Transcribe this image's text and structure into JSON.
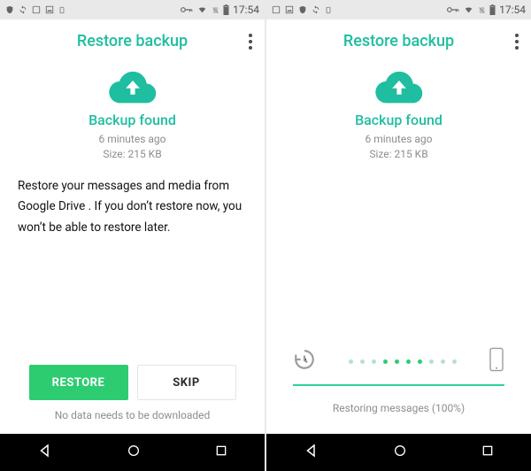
{
  "statusbar": {
    "time": "17:54"
  },
  "left": {
    "title": "Restore backup",
    "backup_found": "Backup found",
    "time_ago": "6 minutes ago",
    "size": "Size: 215 KB",
    "body": "Restore your messages and media from Google Drive . If you don’t restore now, you won’t be able to restore later.",
    "restore_label": "RESTORE",
    "skip_label": "SKIP",
    "footnote": "No data needs to be downloaded"
  },
  "right": {
    "title": "Restore backup",
    "backup_found": "Backup found",
    "time_ago": "6 minutes ago",
    "size": "Size: 215 KB",
    "progress_text": "Restoring messages (100%)"
  }
}
